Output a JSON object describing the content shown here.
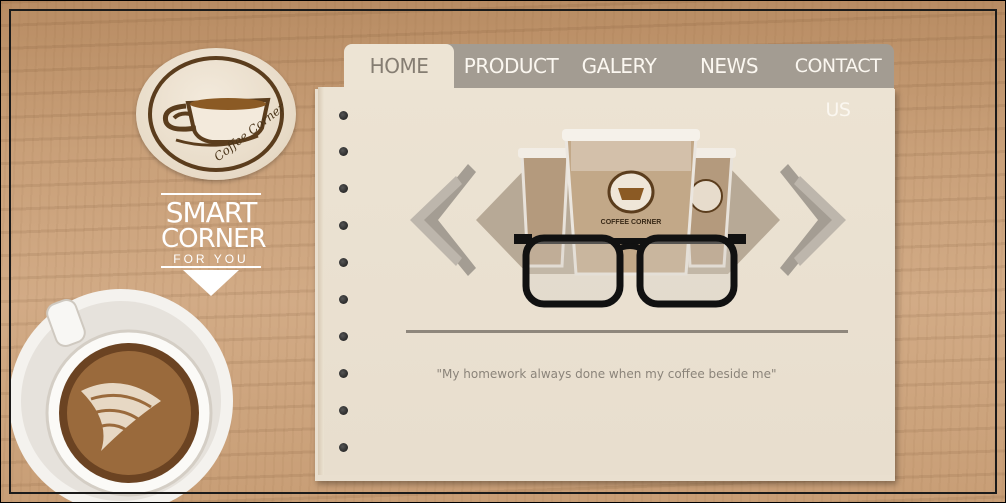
{
  "brand": {
    "logo_text": "Coffee Corner",
    "tagline_line1": "SMART",
    "tagline_line2": "CORNER",
    "tagline_line3": "FOR YOU"
  },
  "nav": {
    "tabs": [
      {
        "label": "HOME",
        "active": true
      },
      {
        "label": "PRODUCT",
        "active": false
      },
      {
        "label": "GALERY",
        "active": false
      },
      {
        "label": "NEWS",
        "active": false
      },
      {
        "label": "CONTACT US",
        "active": false
      }
    ]
  },
  "slider": {
    "cup_label": "COFFEE CORNER",
    "cup_logo_text": "Coffee Corner",
    "prev_icon": "chevron-left-icon",
    "next_icon": "chevron-right-icon"
  },
  "quote": "\"My homework always done when my coffee beside me\"",
  "colors": {
    "tab_bar": "#a39c92",
    "paper": "#ece3d3",
    "accent_brown": "#6b4a25",
    "wood": "#c9a079"
  }
}
